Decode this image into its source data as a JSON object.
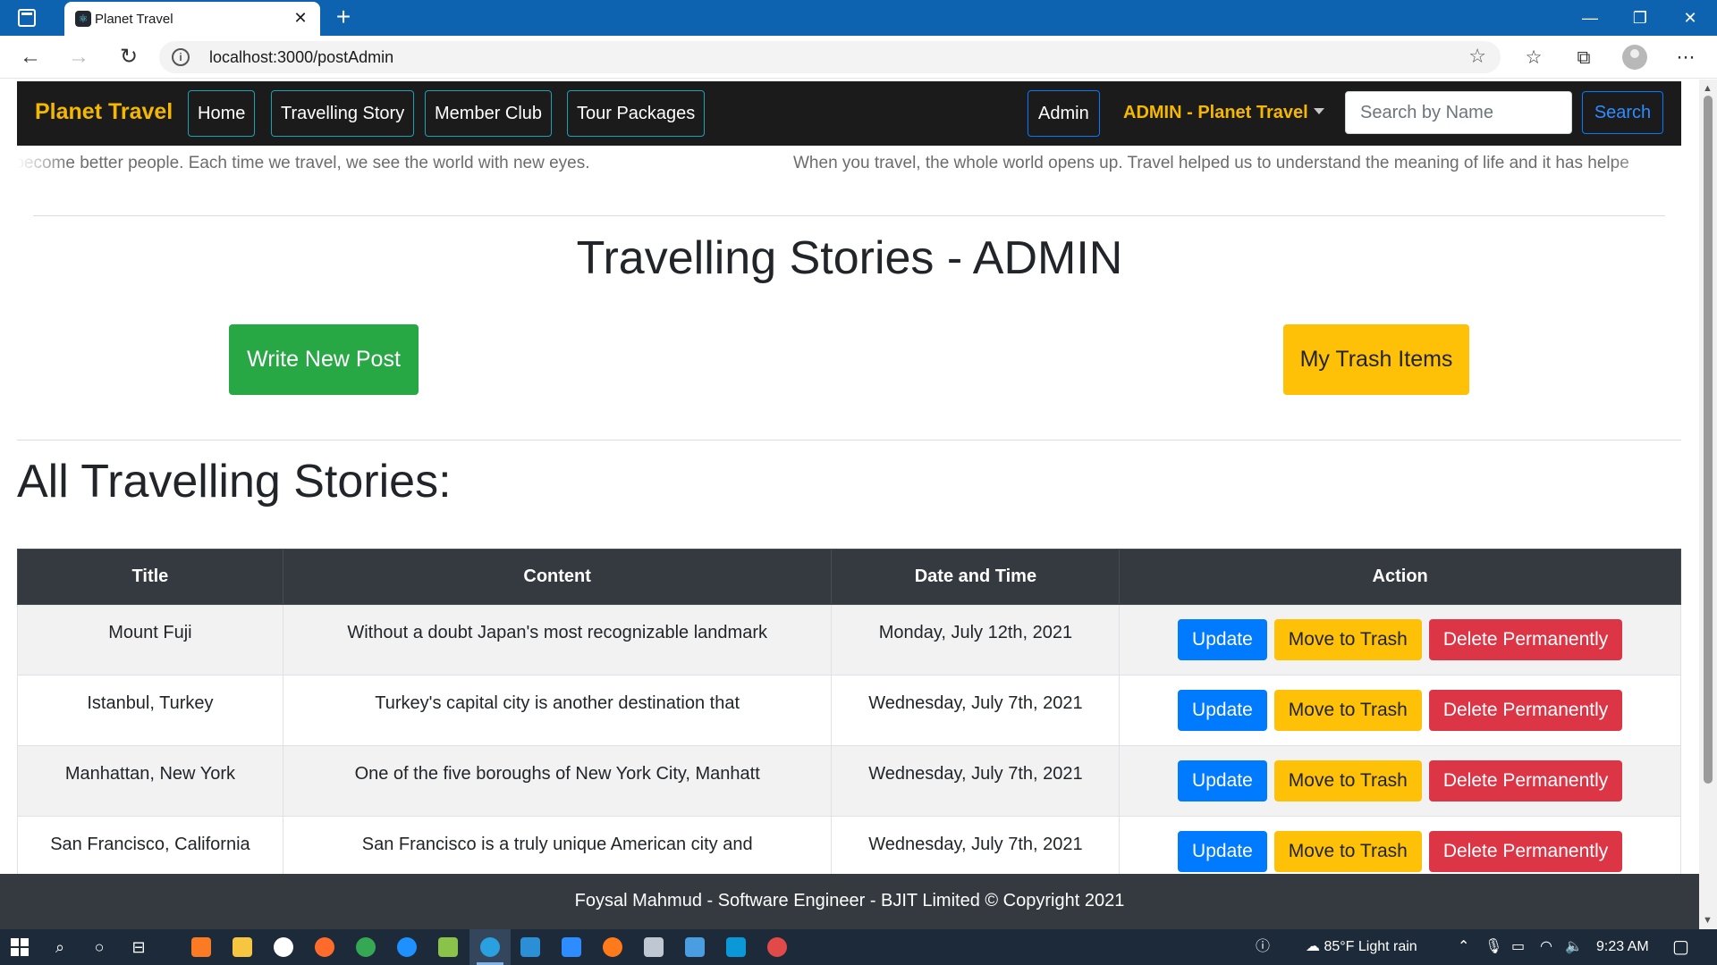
{
  "browser": {
    "tab_title": "Planet Travel",
    "tab_favicon": "react-icon",
    "url": "localhost:3000/postAdmin"
  },
  "nav": {
    "brand": "Planet Travel",
    "links": [
      "Home",
      "Travelling Story",
      "Member Club",
      "Tour Packages"
    ],
    "admin_button": "Admin",
    "admin_dropdown": "ADMIN - Planet Travel",
    "search_placeholder": "Search by Name",
    "search_button": "Search"
  },
  "marquee": {
    "text1": "us become better people. Each time we travel, we see the world with new eyes.",
    "text2": "When you travel, the whole world opens up. Travel helped us to understand the meaning of life and it has helpe"
  },
  "page": {
    "heading": "Travelling Stories - ADMIN",
    "write_button": "Write New Post",
    "trash_button": "My Trash Items",
    "section_heading": "All Travelling Stories:"
  },
  "table": {
    "headers": [
      "Title",
      "Content",
      "Date and Time",
      "Action"
    ],
    "rows": [
      {
        "title": "Mount Fuji",
        "content": "Without a doubt Japan's most recognizable landmark",
        "date": "Monday, July 12th, 2021"
      },
      {
        "title": "Istanbul, Turkey",
        "content": "Turkey's capital city is another destination that",
        "date": "Wednesday, July 7th, 2021"
      },
      {
        "title": "Manhattan, New York",
        "content": "One of the five boroughs of New York City, Manhatt",
        "date": "Wednesday, July 7th, 2021"
      },
      {
        "title": "San Francisco, California",
        "content": "San Francisco is a truly unique American city and",
        "date": "Wednesday, July 7th, 2021"
      }
    ],
    "actions": {
      "update": "Update",
      "move": "Move to Trash",
      "delete": "Delete Permanently"
    }
  },
  "footer": {
    "text": "Foysal Mahmud - Software Engineer - BJIT Limited © Copyright 2021"
  },
  "taskbar": {
    "weather": "85°F  Light rain",
    "time": "9:23 AM"
  },
  "colors": {
    "titlebar": "#0d63b0",
    "navbar": "#1b1b1b",
    "brand": "#f5b800",
    "success": "#28a745",
    "warning": "#ffc107",
    "primary": "#007bff",
    "danger": "#dc3545",
    "table_header": "#343a40"
  }
}
